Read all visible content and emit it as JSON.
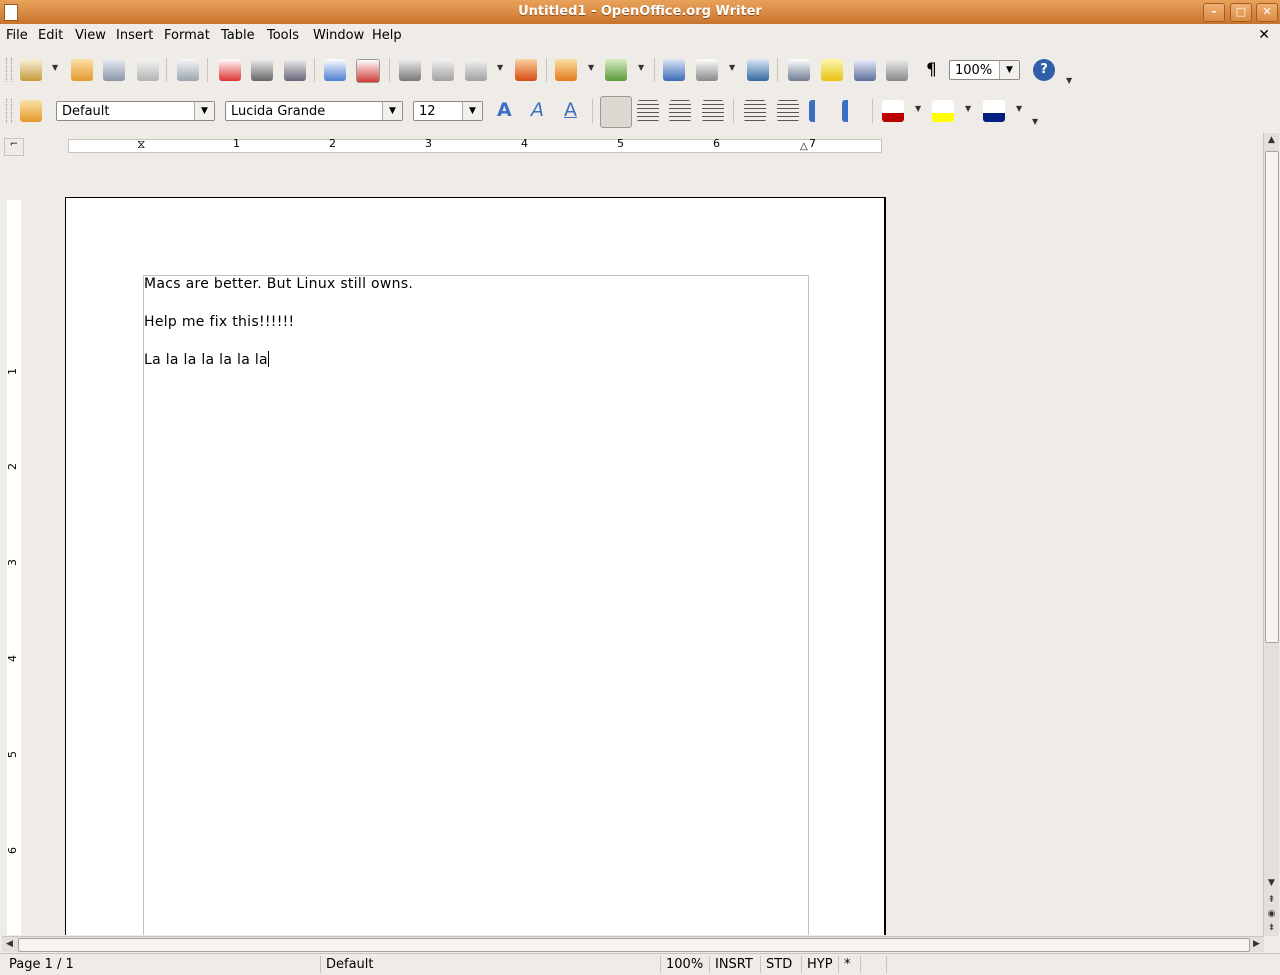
{
  "window": {
    "title": "Untitled1 - OpenOffice.org Writer",
    "minimize": "–",
    "maximize": "□",
    "close": "✕"
  },
  "menu": {
    "items": [
      "File",
      "Edit",
      "View",
      "Insert",
      "Format",
      "Table",
      "Tools",
      "Window",
      "Help"
    ],
    "close_document": "✕"
  },
  "toolbar": {
    "standard_icons": [
      "new-document-icon",
      "open-icon",
      "save-icon",
      "email-icon",
      "edit-file-icon",
      "export-pdf-icon",
      "print-icon",
      "print-preview-icon",
      "spellcheck-icon",
      "autospellcheck-icon",
      "cut-icon",
      "copy-icon",
      "paste-icon",
      "format-paintbrush-icon",
      "undo-icon",
      "redo-icon",
      "navigator-icon",
      "table-icon",
      "draw-functions-icon",
      "find-replace-icon",
      "gallery-icon",
      "data-sources-icon",
      "nonprinting-chars-icon",
      "help-icon"
    ],
    "zoom_value": "100%",
    "nonprinting_glyph": "¶",
    "help_glyph": "?"
  },
  "formatting": {
    "style": "Default",
    "font": "Lucida Grande",
    "size": "12",
    "bold_glyph": "A",
    "italic_glyph": "A",
    "underline_glyph": "A"
  },
  "ruler": {
    "h_numbers": [
      "1",
      "2",
      "3",
      "4",
      "5",
      "6",
      "7"
    ],
    "v_numbers": [
      "1",
      "2",
      "3",
      "4",
      "5",
      "6"
    ]
  },
  "document": {
    "lines": [
      "Macs are better. But Linux still owns.",
      "Help me fix this!!!!!!",
      "La la la la la la la"
    ]
  },
  "status": {
    "page": "Page 1 / 1",
    "style": "Default",
    "zoom": "100%",
    "insert_mode": "INSRT",
    "selection_mode": "STD",
    "hyphenation": "HYP",
    "modified": "*"
  },
  "colors": {
    "titlebar": "#d98a40",
    "chrome": "#efebe7",
    "page": "#ffffff"
  }
}
